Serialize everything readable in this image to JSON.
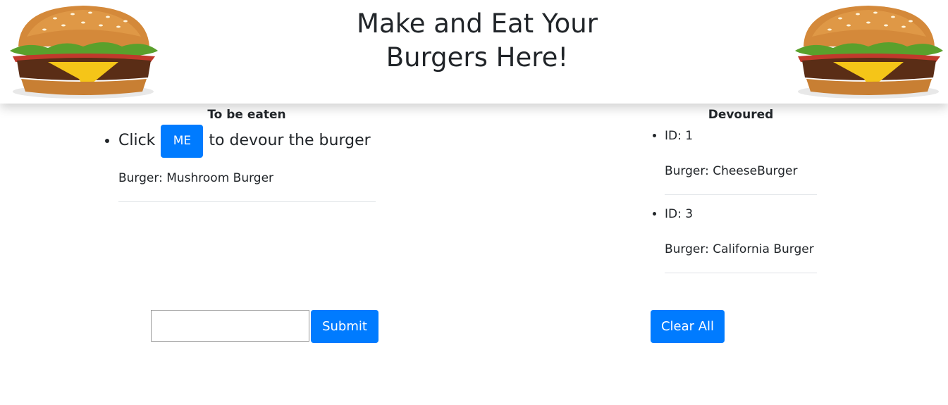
{
  "header": {
    "title": "Make and Eat Your Burgers Here!",
    "left_image_icon": "hamburger-image",
    "right_image_icon": "hamburger-image"
  },
  "to_be_eaten": {
    "title": "To be eaten",
    "items": [
      {
        "prefix": "Click",
        "button_label": "ME",
        "suffix": "to devour the burger",
        "burger_text": "Burger: Mushroom Burger"
      }
    ]
  },
  "devoured": {
    "title": "Devoured",
    "items": [
      {
        "id_text": "ID: 1",
        "burger_text": "Burger: CheeseBurger"
      },
      {
        "id_text": "ID: 3",
        "burger_text": "Burger: California Burger"
      }
    ]
  },
  "form": {
    "input_value": "",
    "input_placeholder": "",
    "submit_label": "Submit"
  },
  "clear_all_label": "Clear All",
  "colors": {
    "primary": "#007bff",
    "text": "#212529",
    "divider": "#dee2e6"
  }
}
